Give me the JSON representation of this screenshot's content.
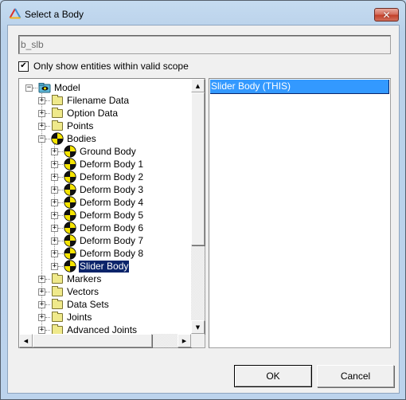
{
  "window": {
    "title": "Select a Body",
    "app_icon": "altair-logo-icon",
    "close_label": "✕"
  },
  "name_field": {
    "value": "b_slb"
  },
  "scope_checkbox": {
    "label": "Only show entities within valid scope",
    "checked": true,
    "mark": "✔"
  },
  "tree": {
    "expander_plus": "+",
    "expander_minus": "−",
    "items": [
      {
        "label": "Model",
        "level": 0,
        "icon": "model-icon",
        "expander": "minus"
      },
      {
        "label": "Filename Data",
        "level": 1,
        "icon": "folder-icon",
        "expander": "plus"
      },
      {
        "label": "Option Data",
        "level": 1,
        "icon": "folder-icon",
        "expander": "plus"
      },
      {
        "label": "Points",
        "level": 1,
        "icon": "folder-icon",
        "expander": "plus"
      },
      {
        "label": "Bodies",
        "level": 1,
        "icon": "body-icon",
        "expander": "minus"
      },
      {
        "label": "Ground Body",
        "level": 2,
        "icon": "body-icon",
        "expander": "plus"
      },
      {
        "label": "Deform Body 1",
        "level": 2,
        "icon": "body-icon",
        "expander": "plus"
      },
      {
        "label": "Deform Body 2",
        "level": 2,
        "icon": "body-icon",
        "expander": "plus"
      },
      {
        "label": "Deform Body 3",
        "level": 2,
        "icon": "body-icon",
        "expander": "plus"
      },
      {
        "label": "Deform Body 4",
        "level": 2,
        "icon": "body-icon",
        "expander": "plus"
      },
      {
        "label": "Deform Body 5",
        "level": 2,
        "icon": "body-icon",
        "expander": "plus"
      },
      {
        "label": "Deform Body 6",
        "level": 2,
        "icon": "body-icon",
        "expander": "plus"
      },
      {
        "label": "Deform Body 7",
        "level": 2,
        "icon": "body-icon",
        "expander": "plus"
      },
      {
        "label": "Deform Body 8",
        "level": 2,
        "icon": "body-icon",
        "expander": "plus"
      },
      {
        "label": "Slider Body",
        "level": 2,
        "icon": "body-icon",
        "expander": "plus",
        "selected": true
      },
      {
        "label": "Markers",
        "level": 1,
        "icon": "folder-icon",
        "expander": "plus"
      },
      {
        "label": "Vectors",
        "level": 1,
        "icon": "folder-icon",
        "expander": "plus"
      },
      {
        "label": "Data Sets",
        "level": 1,
        "icon": "folder-icon",
        "expander": "plus"
      },
      {
        "label": "Joints",
        "level": 1,
        "icon": "folder-icon",
        "expander": "plus"
      },
      {
        "label": "Advanced Joints",
        "level": 1,
        "icon": "folder-icon",
        "expander": "plus"
      }
    ]
  },
  "scrollbars": {
    "up_arrow": "▲",
    "down_arrow": "▼",
    "left_arrow": "◀",
    "right_arrow": "▶",
    "vertical_position": 0.0,
    "horizontal_position": 0.0
  },
  "selection_list": {
    "items": [
      {
        "label": "Slider Body (THIS)",
        "selected": true
      }
    ]
  },
  "buttons": {
    "ok": "OK",
    "cancel": "Cancel"
  },
  "colors": {
    "tree_selection_bg": "#0a246a",
    "list_selection_bg": "#3399ff",
    "body_icon_yellow": "#f5e400",
    "folder_yellow": "#efe98b"
  }
}
